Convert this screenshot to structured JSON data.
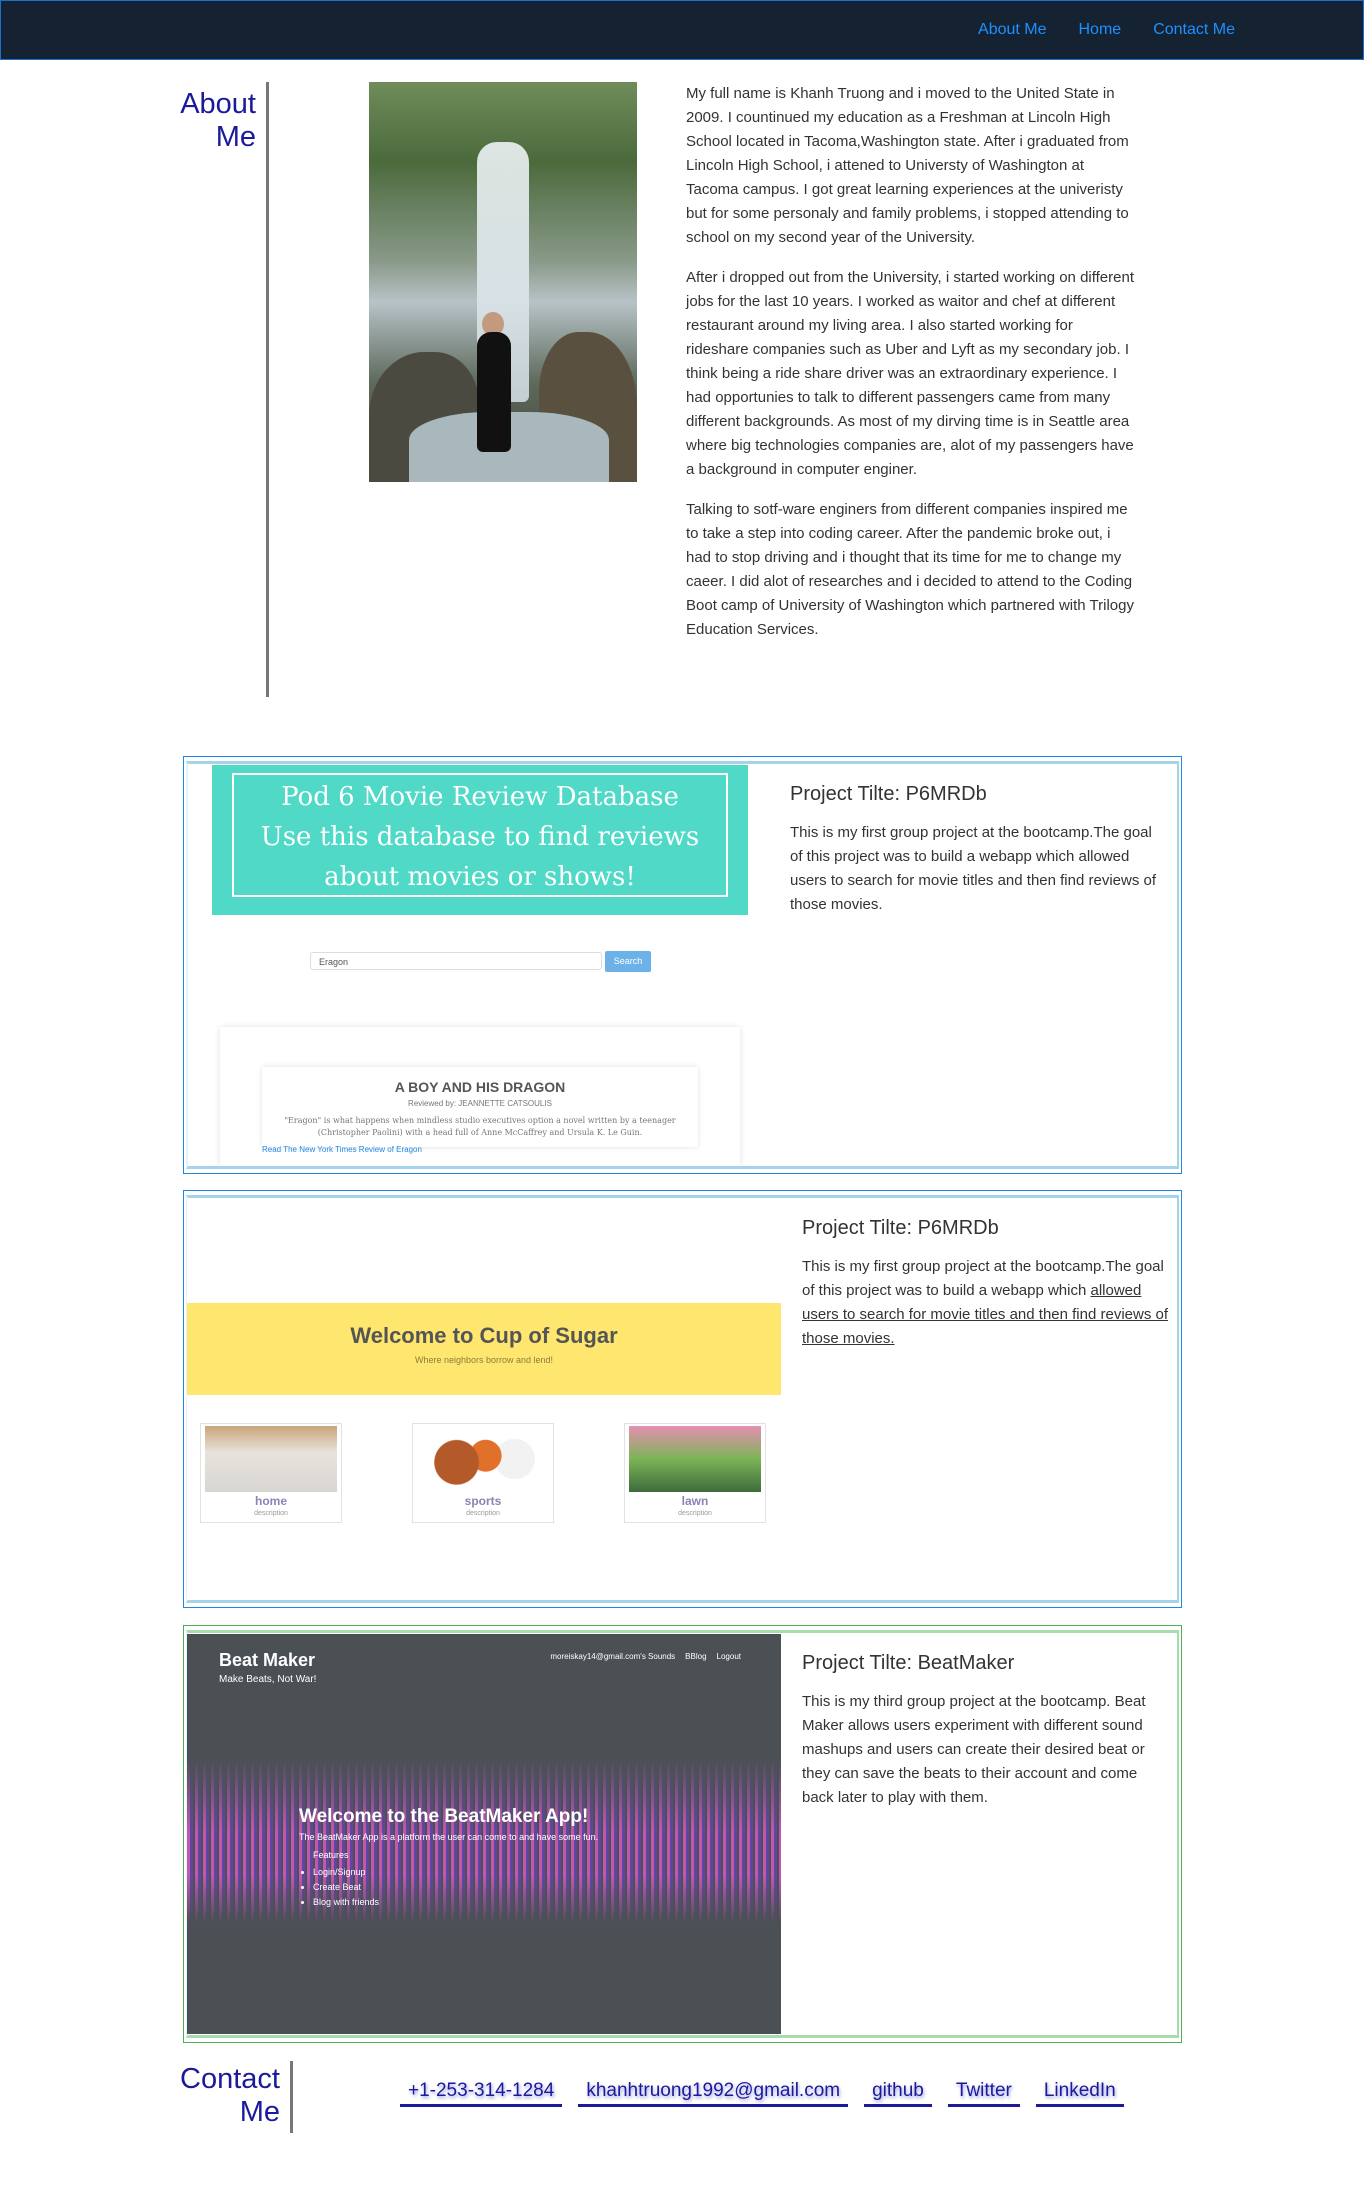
{
  "nav": {
    "links": [
      "About Me",
      "Home",
      "Contact Me"
    ]
  },
  "about": {
    "heading_line1": "About",
    "heading_line2": "Me",
    "paragraphs": [
      "My full name is Khanh Truong and i moved to the United State in 2009. I countinued my education as a Freshman at Lincoln High School located in Tacoma,Washington state. After i graduated from Lincoln High School, i attened to Universty of Washington at Tacoma campus. I got great learning experiences at the univeristy but for some personaly and family problems, i stopped attending to school on my second year of the University.",
      "After i dropped out from the University, i started working on different jobs for the last 10 years. I worked as waitor and chef at different restaurant around my living area. I also started working for rideshare companies such as Uber and Lyft as my secondary job. I think being a ride share driver was an extraordinary experience. I had opportunies to talk to different passengers came from many different backgrounds. As most of my dirving time is in Seattle area where big technologies companies are, alot of my passengers have a background in computer enginer.",
      "Talking to sotf-ware enginers from different companies inspired me to take a step into coding career. After the pandemic broke out, i had to stop driving and i thought that its time for me to change my caeer. I did alot of researches and i decided to attend to the Coding Boot camp of University of Washington which partnered with Trilogy Education Services."
    ]
  },
  "projects": [
    {
      "title": "Project Tilte: P6MRDb",
      "desc": "This is my first group project at the bootcamp.The goal of this project was to build a webapp which allowed users to search for movie titles and then find reviews of those movies.",
      "shot": {
        "banner_line1": "Pod 6 Movie Review Database",
        "banner_line2": "Use this database to find reviews about movies or shows!",
        "search_value": "Eragon",
        "search_button": "Search",
        "card_title": "A BOY AND HIS DRAGON",
        "card_reviewer": "Reviewed by: JEANNETTE CATSOULIS",
        "card_quote": "\"Eragon\" is what happens when mindless studio executives option a novel written by a teenager (Christopher Paolini) with a head full of Anne McCaffrey and Ursula K. Le Guin.",
        "card_link": "Read The New York Times Review of Eragon"
      }
    },
    {
      "title": "Project Tilte: P6MRDb",
      "desc_plain": "This is my first group project at the bootcamp.The goal of this project was to build a webapp which",
      "desc_underlined": "allowed users to search for movie titles and then find reviews of those movies.",
      "shot": {
        "banner_title": "Welcome to Cup of Sugar",
        "banner_sub": "Where neighbors borrow and lend!",
        "tiles": [
          {
            "label": "home",
            "desc": "description"
          },
          {
            "label": "sports",
            "desc": "description"
          },
          {
            "label": "lawn",
            "desc": "description"
          }
        ]
      }
    },
    {
      "title": "Project Tilte: BeatMaker",
      "desc": "This is my third group project at the bootcamp. Beat Maker allows users experiment with different sound mashups and users can create their desired beat or they can save the beats to their account and come back later to play with them.",
      "shot": {
        "app_title": "Beat Maker",
        "app_sub": "Make Beats, Not War!",
        "nav": [
          "moreiskay14@gmail.com's Sounds",
          "BBlog",
          "Logout"
        ],
        "welcome": "Welcome to the BeatMaker App!",
        "text": "The BeatMaker App is a platform the user can come to and have some fun.",
        "features_label": "Features",
        "features": [
          "Login/Signup",
          "Create Beat",
          "Blog with friends"
        ]
      }
    }
  ],
  "contact": {
    "heading_line1": "Contact",
    "heading_line2": "Me",
    "links": [
      "+1-253-314-1284",
      "khanhtruong1992@gmail.com",
      "github",
      "Twitter",
      "LinkedIn"
    ]
  }
}
